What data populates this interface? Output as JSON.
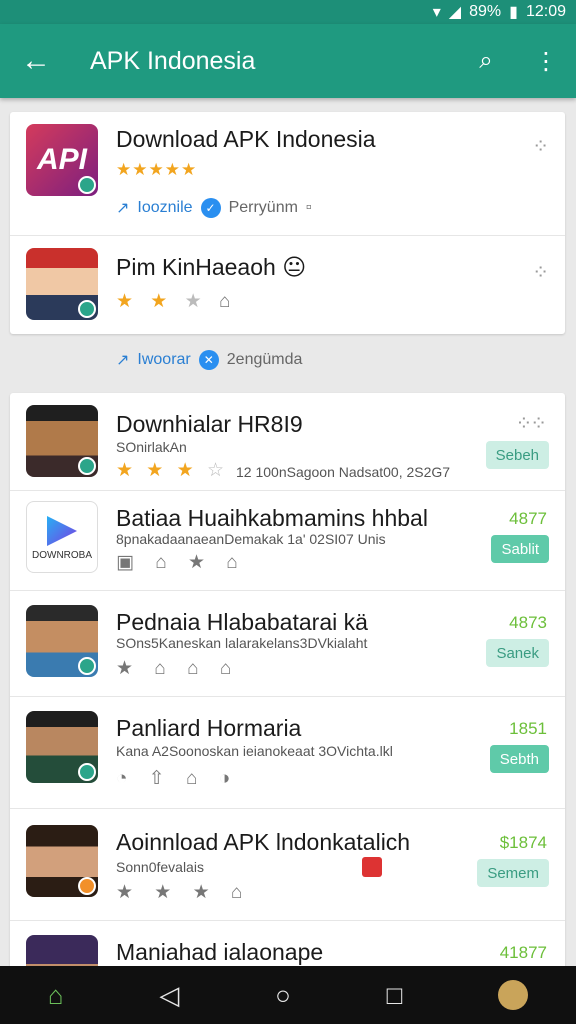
{
  "status": {
    "battery": "89%",
    "time": "12:09"
  },
  "appbar": {
    "back_glyph": "←",
    "title": "APK Indonesia",
    "search_glyph": "⌕",
    "more_glyph": "⋮"
  },
  "featured": [
    {
      "name": "Download APK Indonesia",
      "stars": "★★★★★",
      "meta_left": "Iooznile",
      "meta_right": "Perryünm",
      "thumb_text": "API"
    },
    {
      "name": "Pim KinHaeaoh 😐",
      "stars_on": "★ ★",
      "stars_off": "★",
      "extra": "⌂"
    }
  ],
  "section": {
    "left": "Iwoorar",
    "right": "2engümda"
  },
  "list": [
    {
      "name": "Downhialar HR8I9",
      "sub": "SOnirlakAn",
      "sub2": "12 100nSagoon Nadsat00, 2S2G7",
      "price": "",
      "button": "Sebeh",
      "style": "light",
      "icons_on": "★ ★ ★",
      "icons_off": "☆"
    },
    {
      "name": "Batiaa Huaihkabmamins hhbal",
      "sub": "8pnakadaanaeanDemakak 1a' 02SI07 Unis",
      "price": "4877",
      "button": "Sablit",
      "style": "solid",
      "icons_on": "",
      "icons_off": "▣ ⌂ ★ ⌂",
      "thumb_text": "DOWNROBA"
    },
    {
      "name": "Pednaia Hlababatarai kä",
      "sub": "SOns5Kaneskan lalarakelans3DVkialaht",
      "price": "4873",
      "button": "Sanek",
      "style": "light",
      "icons_on": "",
      "icons_off": "★ ⌂ ⌂ ⌂"
    },
    {
      "name": "Panliard Hormaria",
      "sub": "Kana A2Soonoskan ieianokeaat 3OVichta.lkl",
      "price": "1851",
      "button": "Sebth",
      "style": "solid",
      "icons_on": "",
      "icons_off": "◔ ⇧ ⌂ ◑"
    },
    {
      "name": "Aoinnload APK lndonkatalich",
      "sub": "Sonn0fevalais",
      "price": "$1874",
      "button": "Semem",
      "style": "light",
      "icons_on": "",
      "icons_off": "★ ★ ★ ⌂"
    },
    {
      "name": "Maniahad ialaonape",
      "sub": "",
      "price": "41877",
      "button": "",
      "style": "",
      "icons_on": "",
      "icons_off": ""
    }
  ],
  "nav": {
    "back": "◁",
    "home": "○",
    "recents": "□"
  }
}
